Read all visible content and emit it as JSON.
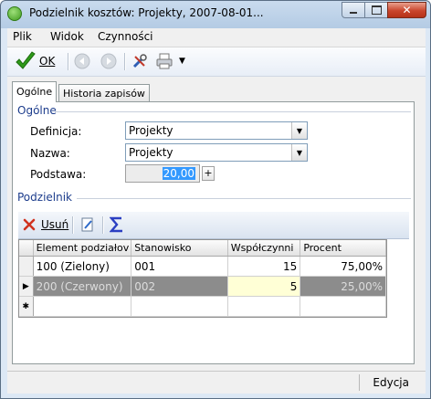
{
  "window": {
    "title": "Podzielnik kosztów: Projekty, 2007-08-01..."
  },
  "menu": {
    "items": [
      "Plik",
      "Widok",
      "Czynności"
    ]
  },
  "toolbar": {
    "ok_label": "OK"
  },
  "tabs": [
    {
      "label": "Ogólne",
      "active": true
    },
    {
      "label": "Historia zapisów",
      "active": false
    }
  ],
  "general": {
    "group_title": "Ogólne",
    "definicja": {
      "label": "Definicja:",
      "value": "Projekty"
    },
    "nazwa": {
      "label": "Nazwa:",
      "value": "Projekty"
    },
    "podstawa": {
      "label": "Podstawa:",
      "value": "20,00"
    }
  },
  "divider": {
    "group_title": "Podzielnik",
    "delete_label": "Usuń",
    "columns": [
      "Element podziałov",
      "Stanowisko",
      "Współczynni",
      "Procent"
    ],
    "rows": [
      {
        "element": "100 (Zielony)",
        "stanowisko": "001",
        "wspolczynnik": "15",
        "procent": "75,00%"
      },
      {
        "element": "200 (Czerwony)",
        "stanowisko": "002",
        "wspolczynnik": "5",
        "procent": "25,00%"
      }
    ]
  },
  "status": {
    "mode": "Edycja"
  },
  "colors": {
    "accent": "#1c3c8c",
    "selected_row": "#8c8c8c",
    "edit_cell": "#ffffd6",
    "ok_check": "#2e9a1a"
  }
}
